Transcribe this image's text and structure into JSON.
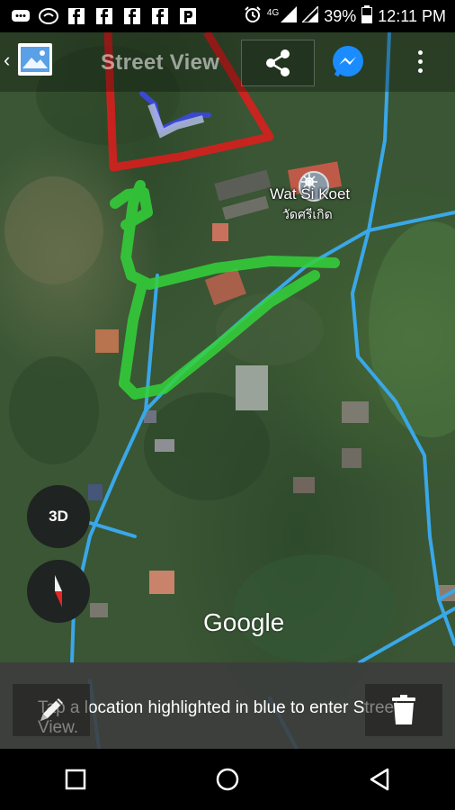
{
  "status_bar": {
    "battery_percent": "39%",
    "time": "12:11 PM",
    "network": "4G",
    "icons": [
      "message-icon",
      "notification-icon",
      "facebook-icon",
      "facebook-icon",
      "facebook-icon",
      "facebook-icon",
      "parking-icon",
      "alarm-icon",
      "signal-icon",
      "signal-icon",
      "battery-icon"
    ]
  },
  "toolbar": {
    "title": "Street View",
    "icons": [
      "back-chevron-icon",
      "image-thumbnail-icon",
      "share-icon",
      "messenger-icon",
      "more-vert-icon"
    ]
  },
  "map": {
    "place_name": "Wat Si Koet",
    "place_name_local": "วัดศรีเกิด",
    "attribution": "Google",
    "colors": {
      "street_view_line": "#3aa7e8",
      "drawn_green": "#33d23a",
      "drawn_red": "#e01c1c",
      "drawn_blue": "#3b48d0"
    }
  },
  "controls": {
    "three_d_label": "3D",
    "compass": "compass-icon"
  },
  "hint": {
    "text": "Tap a location highlighted in blue to enter Street View.",
    "left_tool": "pencil-icon",
    "right_tool": "trash-icon"
  },
  "nav": {
    "icons": [
      "recents-square-icon",
      "home-circle-icon",
      "back-triangle-icon"
    ]
  }
}
